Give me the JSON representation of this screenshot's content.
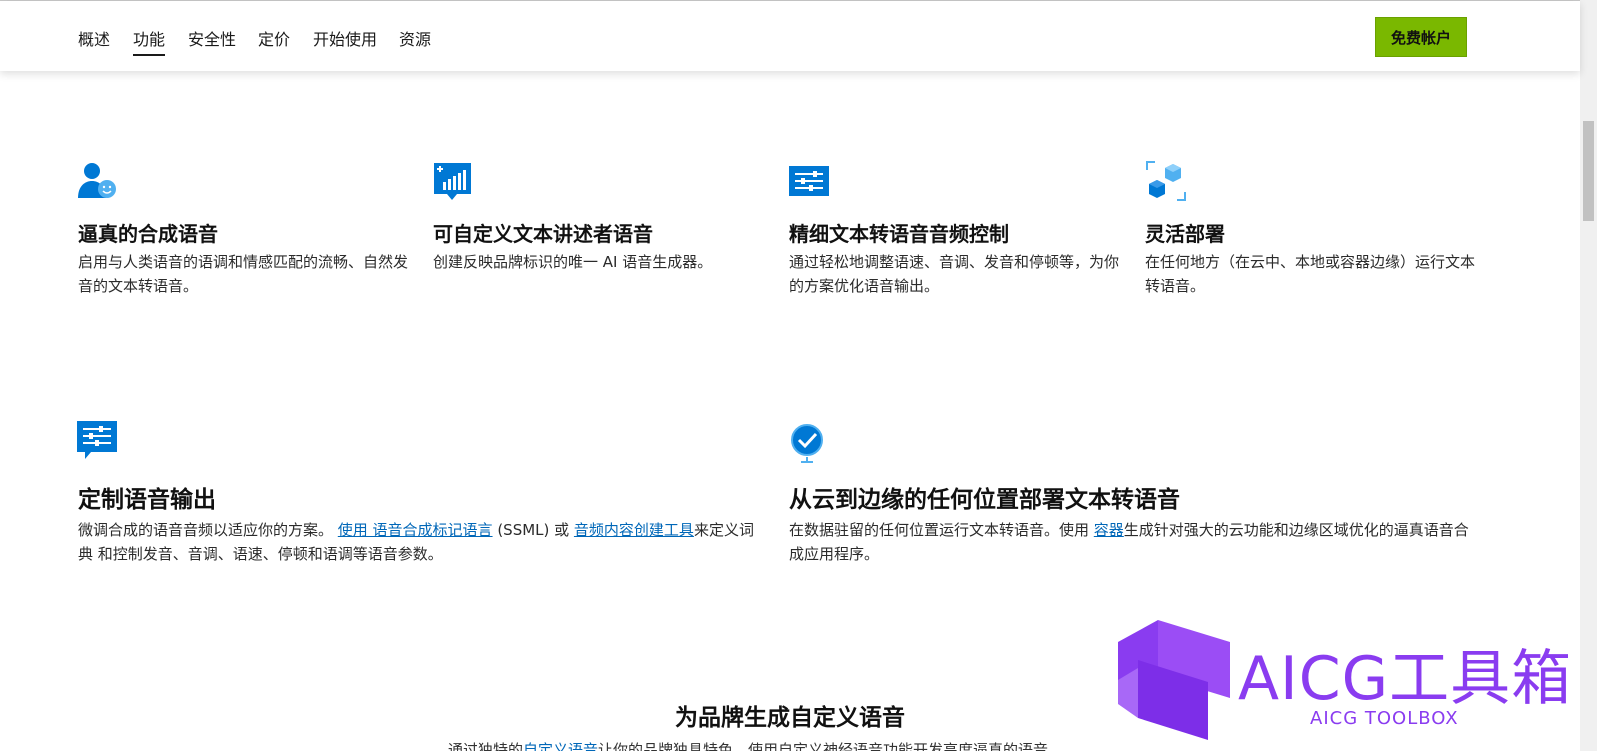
{
  "nav": {
    "items": [
      {
        "label": "概述"
      },
      {
        "label": "功能"
      },
      {
        "label": "安全性"
      },
      {
        "label": "定价"
      },
      {
        "label": "开始使用"
      },
      {
        "label": "资源"
      }
    ],
    "cta_label": "免费帐户"
  },
  "features": [
    {
      "icon": "user-smile-icon",
      "title": "逼真的合成语音",
      "desc": "启用与人类语音的语调和情感匹配的流畅、自然发音的文本转语音。"
    },
    {
      "icon": "chart-bubble-icon",
      "title": "可自定义文本讲述者语音",
      "desc": "创建反映品牌标识的唯一 AI 语音生成器。"
    },
    {
      "icon": "sliders-icon",
      "title": "精细文本转语音音频控制",
      "desc": "通过轻松地调整语速、音调、发音和停顿等，为你的方案优化语音输出。"
    },
    {
      "icon": "cubes-icon",
      "title": "灵活部署",
      "desc": "在任何地方（在云中、本地或容器边缘）运行文本转语音。"
    }
  ],
  "feature_custom": {
    "icon": "sliders-bubble-icon",
    "title": "定制语音输出",
    "desc_part1": "微调合成的语音音频以适应你的方案。 ",
    "link1": "使用 语音合成标记语言",
    "desc_part2": " (SSML) 或 ",
    "link2": "音频内容创建工具",
    "desc_part3": "来定义词典 和控制发音、音调、语速、停顿和语调等语音参数。"
  },
  "feature_edge": {
    "icon": "globe-check-icon",
    "title": "从云到边缘的任何位置部署文本转语音",
    "desc_part1": "在数据驻留的任何位置运行文本转语音。使用 ",
    "link": "容器",
    "desc_part2": "生成针对强大的云功能和边缘区域优化的逼真语音合成应用程序。"
  },
  "section": {
    "title": "为品牌生成自定义语音",
    "clipped_text_a": "通过独特的",
    "clipped_link": "自定义语音",
    "clipped_text_b": "让你的品牌独具特色，使用自定义神经语音功能开发高度逼真的语音"
  },
  "watermark": {
    "title": "AICG工具箱",
    "subtitle": "AICG TOOLBOX"
  },
  "colors": {
    "accent_green": "#7ab800",
    "icon_blue": "#0078d4",
    "link_blue": "#0067b8",
    "watermark_purple": "#8a3cf0"
  }
}
